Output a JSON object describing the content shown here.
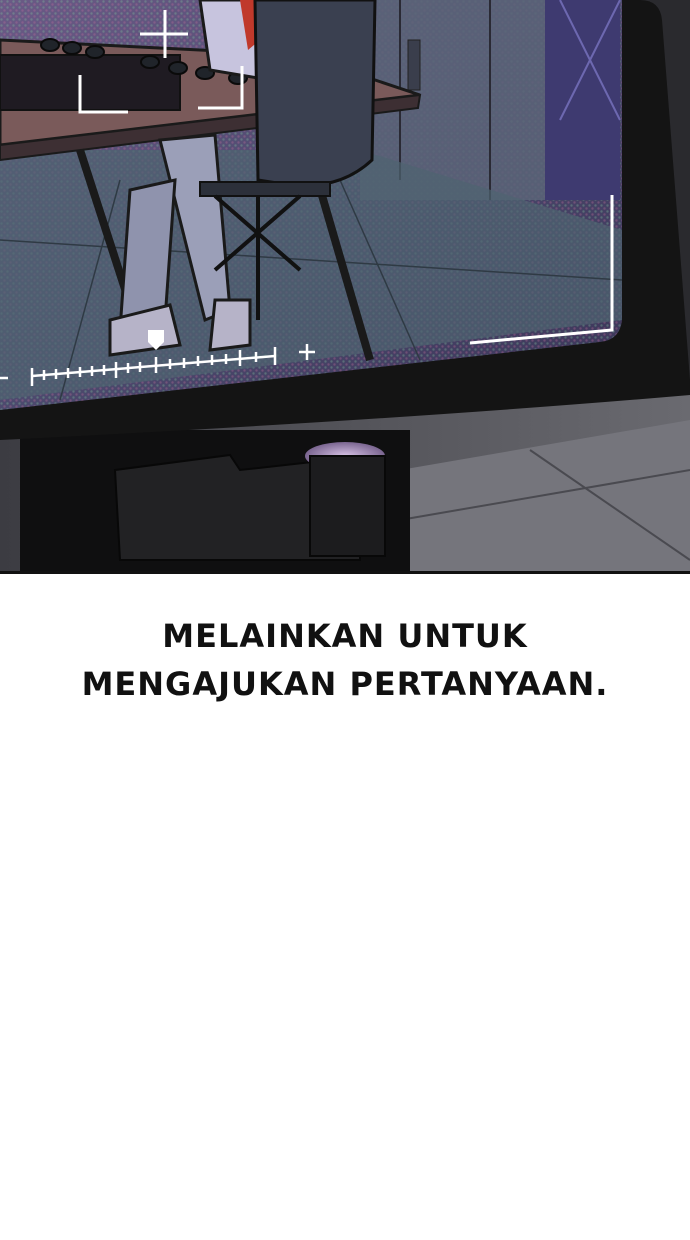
{
  "caption": {
    "line1": "MELAINKAN UNTUK",
    "line2": "MENGAJUKAN PERTANYAAN."
  },
  "panel": {
    "scene": "viewfinder-monitor-meeting-room",
    "colors": {
      "monitor_bezel": "#141414",
      "screen_tint": "#5a3f78",
      "floor": "#5d5d63",
      "viewfinder_marks": "#ffffff",
      "background": "#ffffff",
      "caption_text": "#111111"
    }
  }
}
